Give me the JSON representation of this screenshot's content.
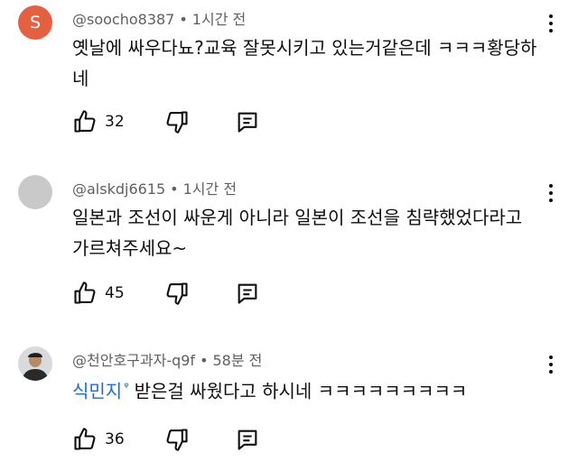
{
  "comments": [
    {
      "handle": "@soocho8387",
      "time": "1시간 전",
      "avatar_letter": "S",
      "avatar_color": "#e5603f",
      "text": "옛날에 싸우다뇨?교육 잘못시키고 있는거같은데 ㅋㅋㅋ황당하네",
      "likes": "32"
    },
    {
      "handle": "@alskdj6615",
      "time": "1시간 전",
      "avatar_letter": "",
      "avatar_color": "#c9c9c9",
      "text": "일본과 조선이 싸운게 아니라 일본이 조선을 침략했었다라고 가르쳐주세요~",
      "likes": "45"
    },
    {
      "handle": "@천안호구과자-q9f",
      "time": "58분 전",
      "avatar_letter": "",
      "avatar_color": "#dcdcdc",
      "mention": "식민지",
      "text": "받은걸 싸웠다고 하시네 ㅋㅋㅋㅋㅋㅋㅋㅋㅋ",
      "likes": "36"
    }
  ],
  "icons": {
    "like": "thumbs-up-icon",
    "dislike": "thumbs-down-icon",
    "reply": "reply-icon",
    "more": "more-vert-icon",
    "mention": "search-icon"
  },
  "separator": "•",
  "mention_glyph": "ᵠ"
}
